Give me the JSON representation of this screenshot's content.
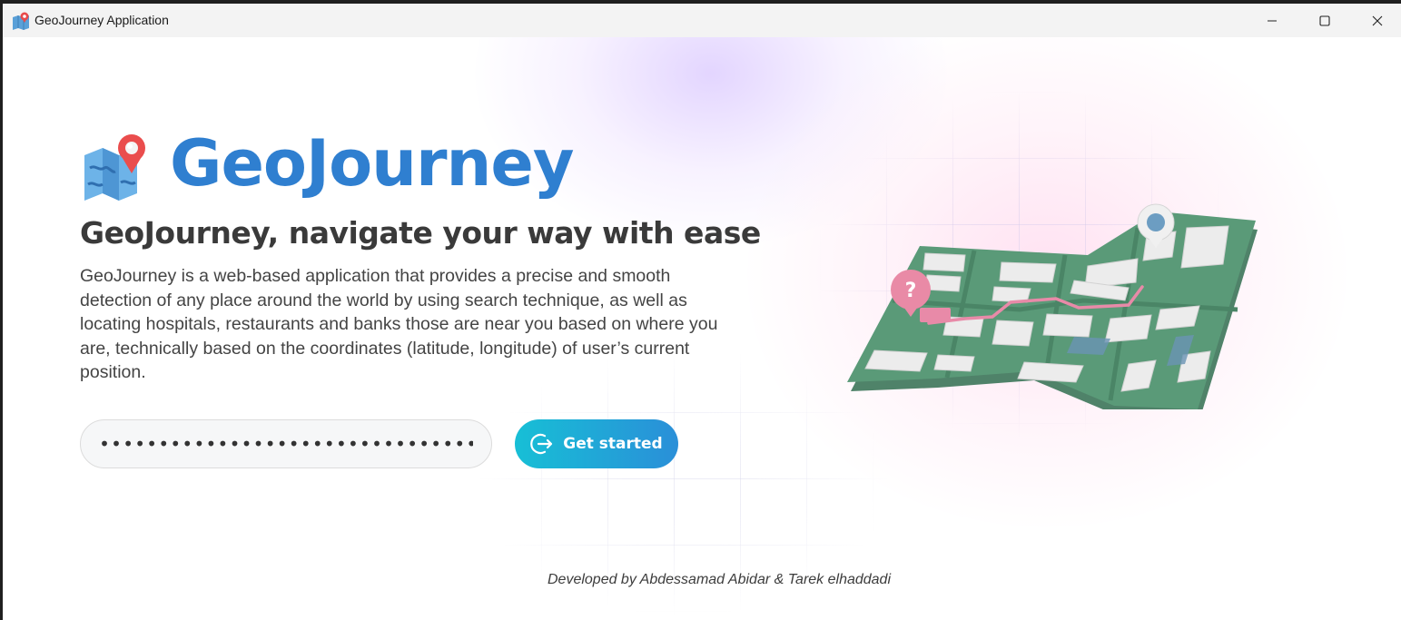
{
  "window": {
    "title": "GeoJourney Application"
  },
  "hero": {
    "brand": "GeoJourney",
    "headline": "GeoJourney, navigate your way with ease",
    "description": "GeoJourney is a web-based application that provides a precise and smooth detection of any place around the world by using search technique, as well as locating hospitals, restaurants and banks those are near you based on where you are, technically based on the coordinates (latitude, longitude) of user’s current position."
  },
  "form": {
    "password_value": "••••••••••••••••••••••••••••••••••••••••",
    "button_label": "Get started"
  },
  "footer": {
    "credit": "Developed by Abdessamad Abidar & Tarek elhaddadi"
  },
  "colors": {
    "brand": "#2f7fd0",
    "button_gradient_start": "#17bfd6",
    "button_gradient_end": "#2a8fd8",
    "map_green": "#4f8f6e",
    "route_pink": "#e88aa8"
  },
  "icons": {
    "app": "map-pin-icon",
    "logo": "map-pin-icon",
    "button": "login-arrow-icon"
  }
}
